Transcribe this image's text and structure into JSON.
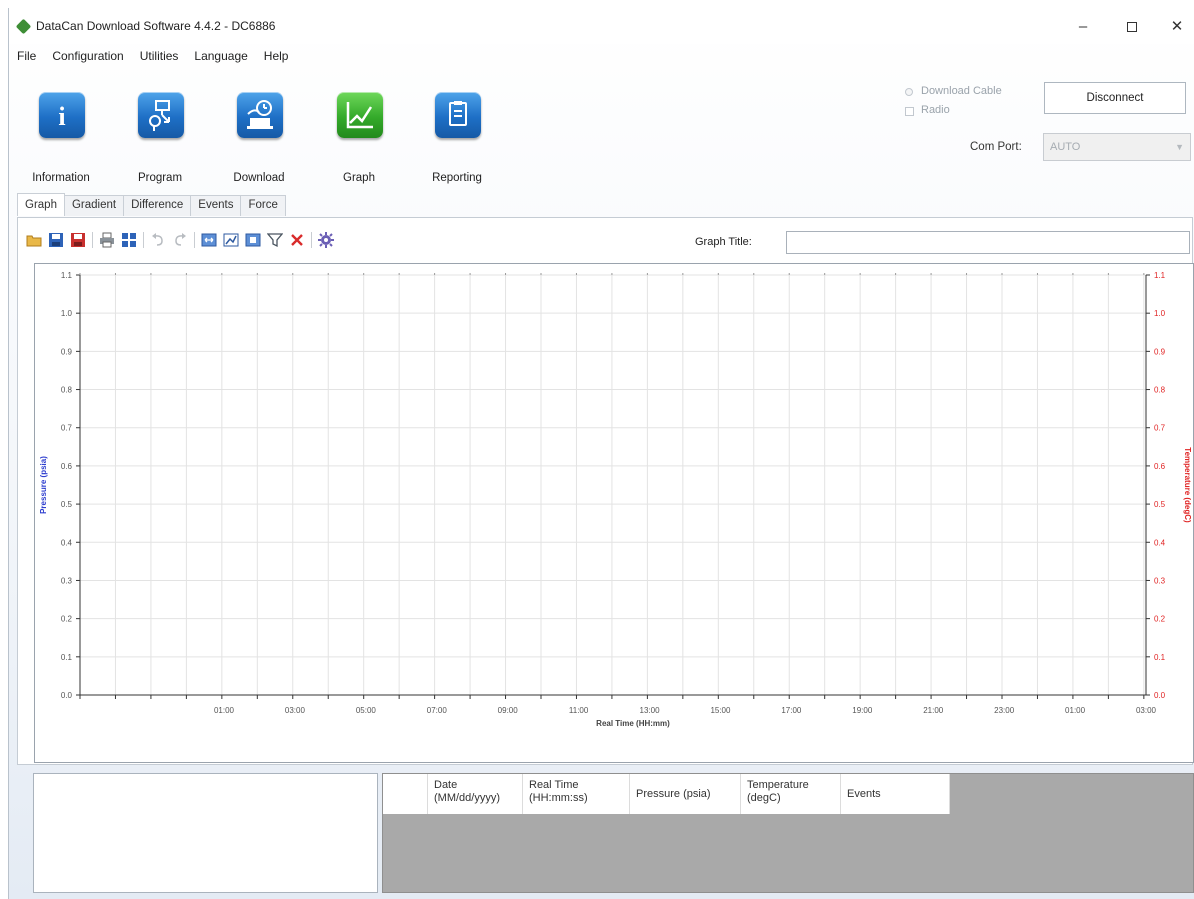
{
  "window": {
    "title": "DataCan Download Software 4.4.2 - DC6886",
    "minimize": "–",
    "close": "✕"
  },
  "menu": [
    "File",
    "Configuration",
    "Utilities",
    "Language",
    "Help"
  ],
  "ribbon": [
    {
      "label": "Information",
      "icon": "info-icon"
    },
    {
      "label": "Program",
      "icon": "program-icon"
    },
    {
      "label": "Download",
      "icon": "download-icon"
    },
    {
      "label": "Graph",
      "icon": "graph-icon"
    },
    {
      "label": "Reporting",
      "icon": "reporting-icon"
    }
  ],
  "connection": {
    "download_cable": "Download Cable",
    "radio": "Radio",
    "disconnect": "Disconnect",
    "com_port_label": "Com Port:",
    "com_port_value": "AUTO"
  },
  "tabs": [
    "Graph",
    "Gradient",
    "Difference",
    "Events",
    "Force"
  ],
  "toolbar": {
    "graph_title_label": "Graph Title:",
    "graph_title_value": ""
  },
  "chart_data": {
    "type": "line",
    "xlabel": "Real Time (HH:mm)",
    "ylabel_left": "Pressure (psia)",
    "ylabel_right": "Temperature (degC)",
    "x_tick_labels": [
      "01:00",
      "03:00",
      "05:00",
      "07:00",
      "09:00",
      "11:00",
      "13:00",
      "15:00",
      "17:00",
      "19:00",
      "21:00",
      "23:00",
      "01:00",
      "03:00"
    ],
    "y_tick_labels": [
      "0.0",
      "0.1",
      "0.2",
      "0.3",
      "0.4",
      "0.5",
      "0.6",
      "0.7",
      "0.8",
      "0.9",
      "1.0",
      "1.1"
    ],
    "ylim": [
      0.0,
      1.1
    ],
    "series": [],
    "grid": true,
    "colors": {
      "left_axis": "#2f3fcf",
      "right_axis": "#e02424"
    }
  },
  "table": {
    "columns": [
      {
        "line1": "Date",
        "line2": "(MM/dd/yyyy)"
      },
      {
        "line1": "Real Time",
        "line2": "(HH:mm:ss)"
      },
      {
        "line1": "Pressure (psia)",
        "line2": ""
      },
      {
        "line1": "Temperature",
        "line2": "(degC)"
      },
      {
        "line1": "Events",
        "line2": ""
      }
    ],
    "rows": []
  }
}
